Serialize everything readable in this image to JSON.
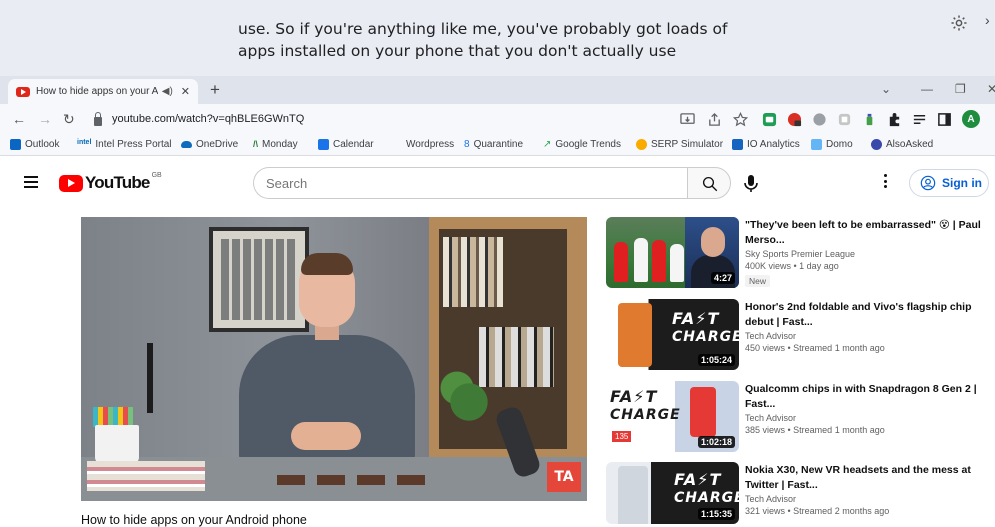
{
  "caption": {
    "lines": [
      "use. So if you're anything like me, you've probably got loads of",
      "apps installed on your phone that you don't actually use"
    ]
  },
  "tab": {
    "title": "How to hide apps on your A",
    "new_tab_symbol": "+"
  },
  "address": {
    "url": "youtube.com/watch?v=qhBLE6GWnTQ",
    "profile_initial": "A"
  },
  "bookmarks": [
    {
      "label": "Outlook",
      "color": "#0a66c2"
    },
    {
      "label": "Intel Press Portal",
      "color": "#0068b5"
    },
    {
      "label": "OneDrive",
      "color": "#0f6cbd"
    },
    {
      "label": "Monday",
      "color": "#2e7d32"
    },
    {
      "label": "Calendar",
      "color": "#1a73e8"
    },
    {
      "label": "Wordpress",
      "color": ""
    },
    {
      "label": "Quarantine",
      "color": "#1a73e8"
    },
    {
      "label": "Google Trends",
      "color": "#34a853"
    },
    {
      "label": "SERP Simulator",
      "color": "#f9ab00"
    },
    {
      "label": "IO Analytics",
      "color": "#1565c0"
    },
    {
      "label": "Domo",
      "color": "#64b5f6"
    },
    {
      "label": "AlsoAsked",
      "color": "#3949ab"
    }
  ],
  "youtube": {
    "wordmark": "YouTube",
    "country": "GB",
    "search_placeholder": "Search",
    "sign_in": "Sign in",
    "brand_red": "#ff0000",
    "link_blue": "#065fd4"
  },
  "video": {
    "title": "How to hide apps on your Android phone",
    "watermark": "TA"
  },
  "recommendations": [
    {
      "title": "\"They've been left to be embarrassed\" 😵 | Paul Merso...",
      "channel": "Sky Sports Premier League",
      "stats": "400K views • 1 day ago",
      "badge": "New",
      "duration": "4:27"
    },
    {
      "title": "Honor's 2nd foldable and Vivo's flagship chip debut | Fast...",
      "channel": "Tech Advisor",
      "stats": "450 views • Streamed 1 month ago",
      "badge": "",
      "duration": "1:05:24",
      "thumb_text": [
        "FA⚡T",
        "CHARGE"
      ]
    },
    {
      "title": "Qualcomm chips in with Snapdragon 8 Gen 2 | Fast...",
      "channel": "Tech Advisor",
      "stats": "385 views • Streamed 1 month ago",
      "badge": "",
      "duration": "1:02:18",
      "thumb_text": [
        "FA⚡T",
        "CHARGE"
      ],
      "thumb_badge": "135"
    },
    {
      "title": "Nokia X30, New VR headsets and the mess at Twitter | Fast...",
      "channel": "Tech Advisor",
      "stats": "321 views • Streamed 2 months ago",
      "badge": "",
      "duration": "1:15:35",
      "thumb_text": [
        "FA⚡T",
        "CHARGE"
      ]
    }
  ]
}
